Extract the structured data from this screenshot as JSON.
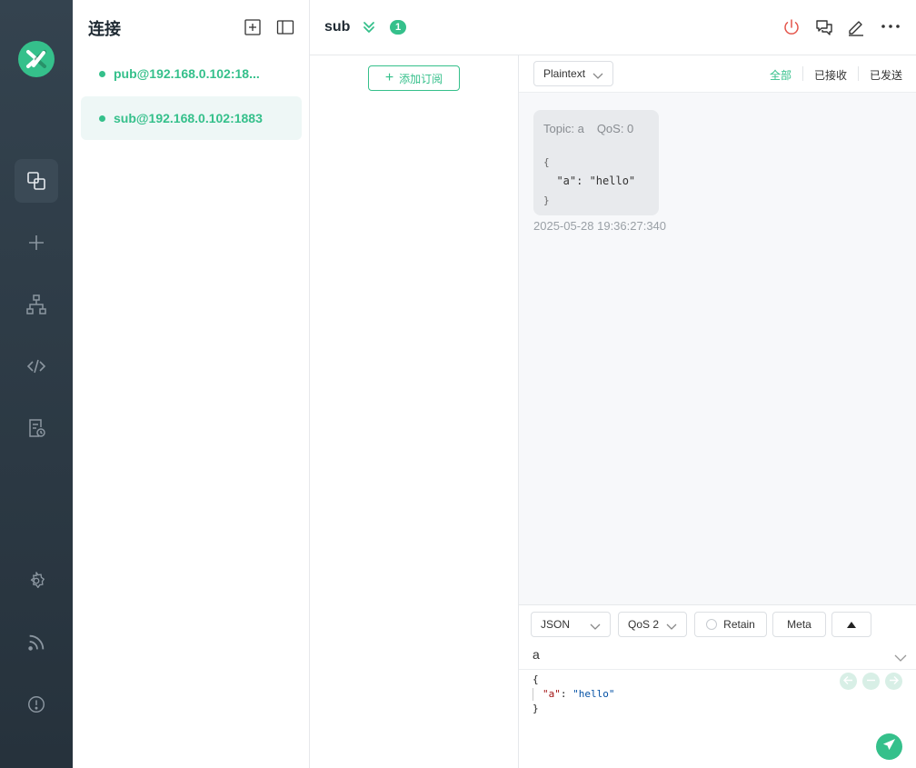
{
  "app": {
    "accent": "#35c08b",
    "rail_bg": "#2b3843"
  },
  "rail": {
    "items": [
      {
        "name": "connections-icon",
        "active": true
      },
      {
        "name": "plus-icon"
      },
      {
        "name": "topology-icon"
      },
      {
        "name": "code-icon"
      },
      {
        "name": "log-icon"
      },
      {
        "name": "gear-icon"
      },
      {
        "name": "rss-icon"
      },
      {
        "name": "info-icon"
      }
    ]
  },
  "connections": {
    "title": "连接",
    "items": [
      {
        "label": "pub@192.168.0.102:18...",
        "status": "connected",
        "active": false
      },
      {
        "label": "sub@192.168.0.102:1883",
        "status": "connected",
        "active": true
      }
    ]
  },
  "header": {
    "title": "sub",
    "badge": "1"
  },
  "subscriptions": {
    "add_label": "添加订阅"
  },
  "messages": {
    "format": "Plaintext",
    "filters": {
      "all": "全部",
      "received": "已接收",
      "sent": "已发送"
    },
    "active_filter": "all",
    "items": [
      {
        "topic": "Topic: a",
        "qos": "QoS: 0",
        "line1": "{",
        "line2": "  \"a\": \"hello\"",
        "line3": "}",
        "time": "2025-05-28 19:36:27:340"
      }
    ]
  },
  "publish": {
    "format": "JSON",
    "qos": "QoS 2",
    "retain_label": "Retain",
    "meta_label": "Meta",
    "topic": "a",
    "payload": {
      "open": "{",
      "key": "\"a\"",
      "colon": ": ",
      "value": "\"hello\"",
      "close": "}"
    }
  }
}
